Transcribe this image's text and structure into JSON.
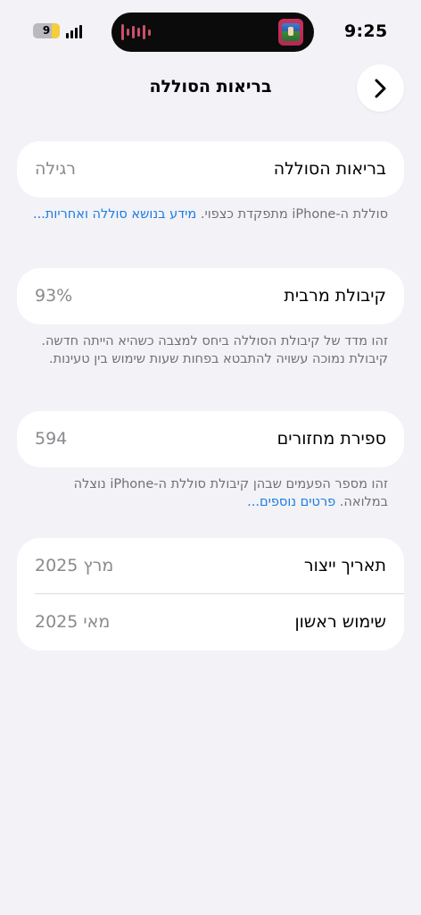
{
  "status_bar": {
    "time": "9:25",
    "battery_percent": "9",
    "battery_level": 0.09
  },
  "page": {
    "title": "בריאות הסוללה"
  },
  "battery_health": {
    "label": "בריאות הסוללה",
    "value": "רגילה",
    "note_text": "סוללת ה-iPhone מתפקדת כצפוי.",
    "note_link": "מידע בנושא סוללה ואחריות..."
  },
  "max_capacity": {
    "label": "קיבולת מרבית",
    "value": "93%",
    "note_text": "זהו מדד של קיבולת הסוללה ביחס למצבה כשהיא הייתה חדשה. קיבולת נמוכה עשויה להתבטא בפחות שעות שימוש בין טעינות."
  },
  "cycle_count": {
    "label": "ספירת מחזורים",
    "value": "594",
    "note_text": "זהו מספר הפעמים שבהן קיבולת סוללת ה-iPhone נוצלה במלואה.",
    "note_link": "פרטים נוספים..."
  },
  "dates": {
    "manufacture_label": "תאריך ייצור",
    "manufacture_value": "מרץ 2025",
    "first_use_label": "שימוש ראשון",
    "first_use_value": "מאי 2025"
  },
  "icons": {
    "back": "chevron-right-icon",
    "signal": "signal-bars-icon",
    "battery": "battery-icon",
    "waveform": "audio-waveform-icon",
    "app": "now-playing-app-icon"
  },
  "colors": {
    "background": "#f2f2f7",
    "card": "#ffffff",
    "link": "#1a7de0",
    "secondary_text": "#8a8a8e"
  }
}
